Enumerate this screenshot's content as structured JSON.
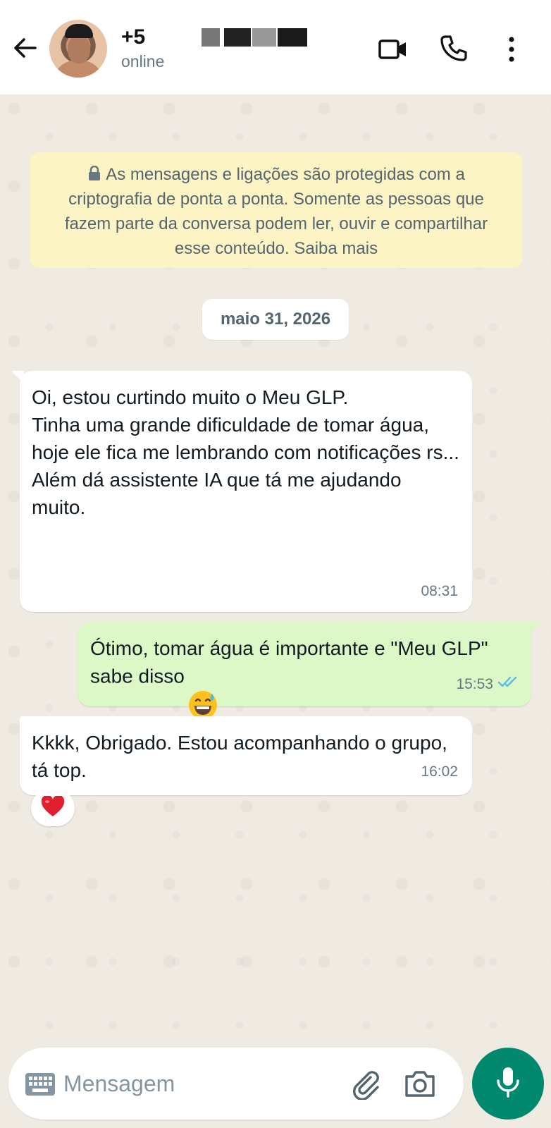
{
  "header": {
    "contact_name": "+5",
    "status": "online"
  },
  "chat": {
    "encryption_notice": "As mensagens e ligações são protegidas com a criptografia de ponta a ponta. Somente as pessoas que fazem parte da conversa podem ler, ouvir e compartilhar esse conteúdo. Saiba mais",
    "date_label": "maio 31, 2026",
    "messages": [
      {
        "direction": "incoming",
        "text": "Oi, estou curtindo muito o Meu GLP.\nTinha uma grande dificuldade de tomar água, hoje ele fica me lembrando com notificações rs...\nAlém dá assistente IA que tá me ajudando muito.",
        "time": "08:31"
      },
      {
        "direction": "outgoing",
        "text": "Ótimo,  tomar água é importante e \"Meu GLP\" sabe disso",
        "emoji": "grinning-sweat",
        "time": "15:53",
        "read": true
      },
      {
        "direction": "incoming",
        "text": "Kkkk, Obrigado. Estou acompanhando o grupo, tá top.",
        "time": "16:02",
        "reaction": "red-heart"
      }
    ]
  },
  "composer": {
    "placeholder": "Mensagem"
  },
  "colors": {
    "accent": "#00896f",
    "outgoing_bubble": "#dcf8c6",
    "read_ticks": "#53bdeb",
    "encryption_bg": "#fdf4c5"
  }
}
